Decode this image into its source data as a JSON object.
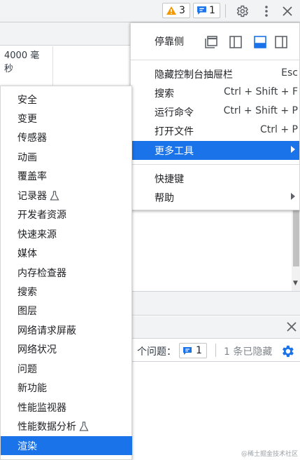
{
  "toolbar": {
    "warnings_count": "3",
    "messages_count": "1",
    "icons": [
      "warning-icon",
      "message-icon",
      "gear-icon",
      "more-vertical-icon",
      "close-icon"
    ]
  },
  "background": {
    "cell_text": "4000 毫秒"
  },
  "main_menu": {
    "dock_label": "停靠侧",
    "dock_options": [
      "undock-icon",
      "dock-left-icon",
      "dock-bottom-icon",
      "dock-right-icon"
    ],
    "items": [
      {
        "label": "隐藏控制台抽屉栏",
        "shortcut": "Esc"
      },
      {
        "label": "搜索",
        "shortcut": "Ctrl + Shift + F"
      },
      {
        "label": "运行命令",
        "shortcut": "Ctrl + Shift + P"
      },
      {
        "label": "打开文件",
        "shortcut": "Ctrl + P"
      },
      {
        "label": "更多工具",
        "shortcut": ""
      }
    ],
    "shortcuts_label": "快捷键",
    "help_label": "帮助"
  },
  "more_tools": {
    "items": [
      {
        "label": "安全",
        "experimental": false
      },
      {
        "label": "变更",
        "experimental": false
      },
      {
        "label": "传感器",
        "experimental": false
      },
      {
        "label": "动画",
        "experimental": false
      },
      {
        "label": "覆盖率",
        "experimental": false
      },
      {
        "label": "记录器",
        "experimental": true
      },
      {
        "label": "开发者资源",
        "experimental": false
      },
      {
        "label": "快速来源",
        "experimental": false
      },
      {
        "label": "媒体",
        "experimental": false
      },
      {
        "label": "内存检查器",
        "experimental": false
      },
      {
        "label": "搜索",
        "experimental": false
      },
      {
        "label": "图层",
        "experimental": false
      },
      {
        "label": "网络请求屏蔽",
        "experimental": false
      },
      {
        "label": "网络状况",
        "experimental": false
      },
      {
        "label": "问题",
        "experimental": false
      },
      {
        "label": "新功能",
        "experimental": false
      },
      {
        "label": "性能监视器",
        "experimental": false
      },
      {
        "label": "性能数据分析",
        "experimental": true
      },
      {
        "label": "渲染",
        "experimental": false
      }
    ],
    "active_index": 18
  },
  "issues_bar": {
    "label": "个问题：",
    "count": "1",
    "hidden_text": "1 条已隐藏"
  },
  "watermark": "@稀土掘金技术社区",
  "colors": {
    "accent": "#1a73e8",
    "warning": "#f29900",
    "toolbar_bg": "#f1f3f4"
  }
}
